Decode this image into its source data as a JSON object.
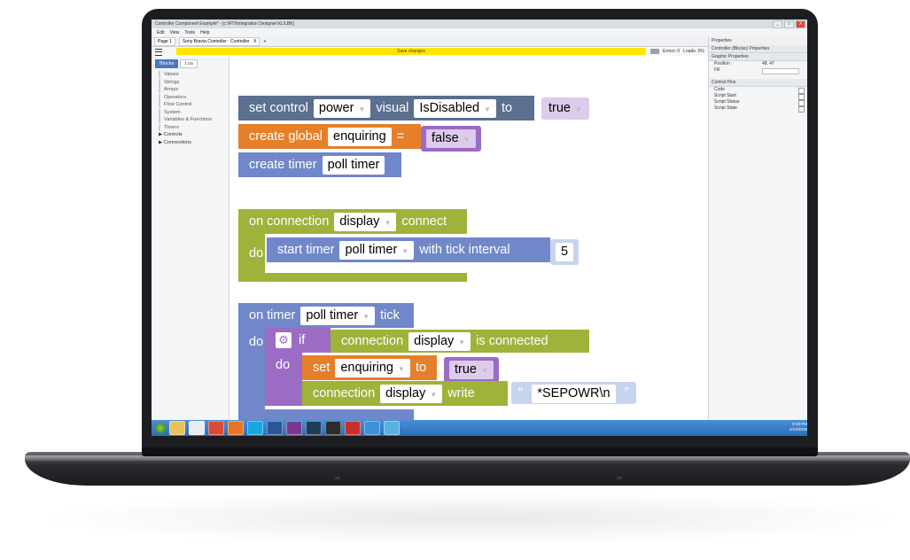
{
  "window": {
    "title": "Controller Component Example* - [c:\\RTI\\Integration Designer\\XL\\LBK]",
    "buttons": [
      "_",
      "□",
      "X"
    ]
  },
  "menu": [
    "Edit",
    "View",
    "Tools",
    "Help"
  ],
  "tabs": [
    {
      "label": "Page 1"
    },
    {
      "label": "Sony Bravia Controller : Controller",
      "close": "X",
      "add": "+"
    }
  ],
  "toolbar": {
    "save_label": "Save changes",
    "errors": "Errors: 0",
    "loads": "Loads: 0%"
  },
  "palette": {
    "tabs": [
      "Blocks",
      "Lua"
    ],
    "items": [
      "Values",
      "Strings",
      "Arrays",
      "Operators",
      "Flow Control",
      "System",
      "Variables & Functions",
      "Timers"
    ],
    "groups": [
      "Controls",
      "Connections"
    ]
  },
  "blocks": {
    "set_control": {
      "label_set": "set control",
      "target": "power",
      "label_visual": "visual",
      "property": "IsDisabled",
      "label_to": "to",
      "value": "true"
    },
    "create_global": {
      "label": "create global",
      "name": "enquiring",
      "eq": "=",
      "value": "false"
    },
    "create_timer": {
      "label": "create timer",
      "name": "poll timer"
    },
    "on_connection": {
      "label_on": "on connection",
      "target": "display",
      "label_event": "connect",
      "label_do": "do"
    },
    "start_timer": {
      "label": "start timer",
      "name": "poll timer",
      "label_interval": "with tick interval",
      "interval": "5"
    },
    "on_timer": {
      "label_on": "on timer",
      "name": "poll timer",
      "label_event": "tick",
      "label_do": "do"
    },
    "if_block": {
      "label_if": "if",
      "label_do": "do"
    },
    "is_connected": {
      "label": "connection",
      "target": "display",
      "label_state": "is connected"
    },
    "set_var": {
      "label_set": "set",
      "name": "enquiring",
      "label_to": "to",
      "value": "true"
    },
    "write": {
      "label": "connection",
      "target": "display",
      "label_write": "write",
      "open_quote": "“",
      "text": "*SEPOWR\\n",
      "close_quote": "”"
    }
  },
  "properties": {
    "tab": "Properties",
    "header": "Controller (Blocks) Properties",
    "section_graphic": "Graphic Properties",
    "rows": [
      {
        "label": "Position",
        "value": "48, 47"
      },
      {
        "label": "Fill",
        "value": ""
      }
    ],
    "section_pins": "Control Pins",
    "pins": [
      "Code",
      "Script Start",
      "Script Status",
      "Script State"
    ]
  },
  "taskbar": {
    "time": "8:33 PM",
    "date": "2/13/2018"
  },
  "colors": {
    "save_bar": "#ffe600",
    "block_control": "#5b6f8e",
    "block_variable": "#e67f2a",
    "block_timer": "#7088c9",
    "block_connection": "#9db33a",
    "block_flow": "#9c6bc4",
    "taskbar": "#2a6fb8"
  }
}
